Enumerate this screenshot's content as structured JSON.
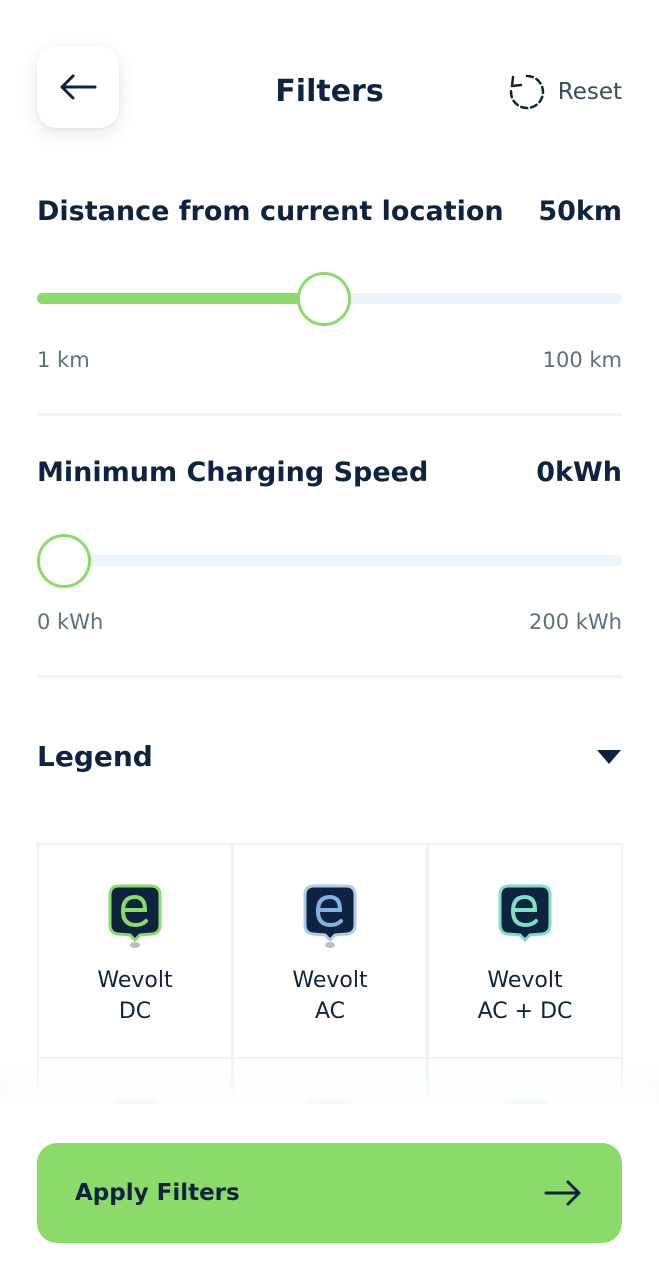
{
  "header": {
    "back_icon": "arrow-left-icon",
    "title": "Filters",
    "reset_icon": "reset-icon",
    "reset_label": "Reset"
  },
  "distance_filter": {
    "title": "Distance from current location",
    "value": "50km",
    "min_label": "1 km",
    "max_label": "100 km",
    "fraction": 0.49
  },
  "speed_filter": {
    "title": "Minimum Charging Speed",
    "value": "0kWh",
    "min_label": "0 kWh",
    "max_label": "200 kWh",
    "fraction": 0
  },
  "legend": {
    "title": "Legend",
    "toggle_icon": "caret-down-icon",
    "items": [
      {
        "line1": "Wevolt",
        "line2": "DC",
        "icon": "wevolt-dc-pin-icon",
        "border": "#8adb69",
        "letter": "#8adb69"
      },
      {
        "line1": "Wevolt",
        "line2": "AC",
        "icon": "wevolt-ac-pin-icon",
        "border": "#7fb3e0",
        "letter": "#7fb3e0"
      },
      {
        "line1": "Wevolt",
        "line2": "AC + DC",
        "icon": "wevolt-acdc-pin-icon",
        "border": "#7de0c0",
        "letter": "#7de0c0"
      }
    ]
  },
  "footer": {
    "apply_label": "Apply Filters",
    "apply_icon": "arrow-right-icon"
  },
  "colors": {
    "accent": "#8adb69",
    "text": "#0f2341",
    "track": "#eef4fb"
  }
}
